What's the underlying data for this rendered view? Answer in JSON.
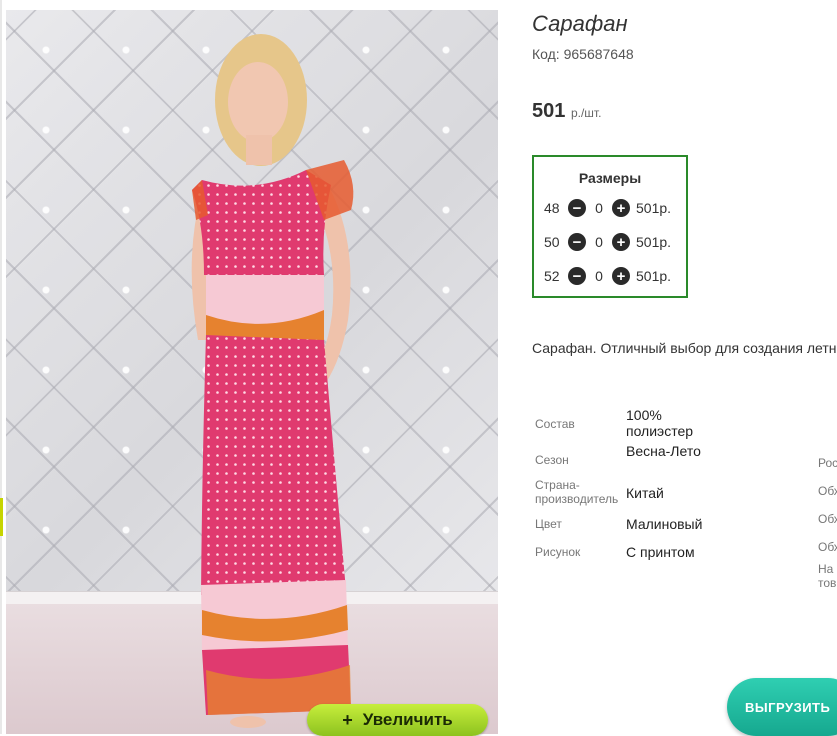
{
  "product": {
    "title": "Сарафан",
    "code": "Код: 965687648",
    "price": "501",
    "price_unit": "р./шт."
  },
  "zoom_button": {
    "icon": "plus-icon",
    "label": "Увеличить"
  },
  "sizes": {
    "header": "Размеры",
    "rows": [
      {
        "size": "48",
        "qty": "0",
        "price": "501р."
      },
      {
        "size": "50",
        "qty": "0",
        "price": "501р."
      },
      {
        "size": "52",
        "qty": "0",
        "price": "501р."
      }
    ]
  },
  "description": "Сарафан. Отличный выбор для создания летн",
  "properties": [
    {
      "label": "Состав",
      "value": "100% полиэстер"
    },
    {
      "label": "Сезон",
      "value": "Весна-Лето"
    },
    {
      "label": "Страна-производитель",
      "value": "Китай"
    },
    {
      "label": "Цвет",
      "value": "Малиновый"
    },
    {
      "label": "Рисунок",
      "value": "С принтом"
    }
  ],
  "right_column": [
    "Рос",
    "Обх",
    "Обх",
    "Обх",
    "На",
    "тов"
  ],
  "export_button": {
    "label": "ВЫГРУЗИТЬ"
  },
  "colors": {
    "sizes_border": "#2a8a2a",
    "zoom_button": "#a8d82e",
    "export_button": "#1fbfa3",
    "dress": "#e03a6f"
  }
}
